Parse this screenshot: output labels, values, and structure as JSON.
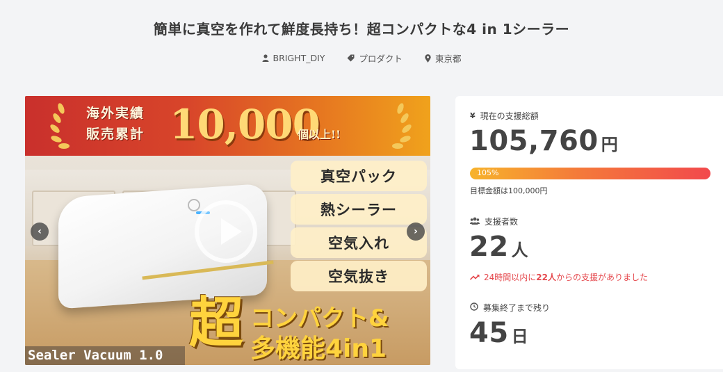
{
  "project": {
    "title": "簡単に真空を作れて鮮度長持ち！超コンパクトな4 in 1シーラー",
    "owner": "BRIGHT_DIY",
    "category": "プロダクト",
    "location": "東京都"
  },
  "media": {
    "banner_sub_line1": "海外実績",
    "banner_sub_line2": "販売累計",
    "banner_big": "10,000",
    "banner_unit": "個以上!!",
    "features": [
      "真空パック",
      "熱シーラー",
      "空気入れ",
      "空気抜き"
    ],
    "caption_big": "超",
    "caption_line1": "コンパクト&",
    "caption_line2": "多機能4in1",
    "product_label": "Sealer Vacuum 1.0",
    "prev_label": "‹",
    "next_label": "›"
  },
  "stats": {
    "total_label": "現在の支援総額",
    "total_value": "105,760",
    "total_unit": "円",
    "progress_text": "105%",
    "progress_percent": 105,
    "goal_text": "目標金額は100,000円",
    "backers_label": "支援者数",
    "backers_value": "22",
    "backers_unit": "人",
    "trend_prefix": "24時間以内に",
    "trend_count": "22人",
    "trend_suffix": "からの支援がありました",
    "remaining_label": "募集終了まで残り",
    "remaining_value": "45",
    "remaining_unit": "日"
  },
  "colors": {
    "accent_red": "#e5484d",
    "progress_start": "#f7b32b",
    "progress_end": "#f2494c"
  }
}
